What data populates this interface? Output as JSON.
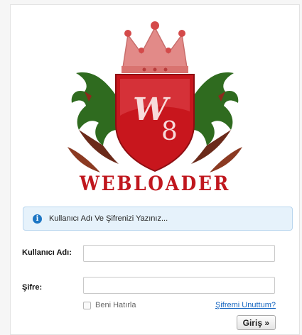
{
  "logo": {
    "monogram": "W",
    "monogram_number": "8",
    "brand": "WEBLOADER"
  },
  "info": {
    "icon": "info-icon",
    "text": "Kullanıcı Adı Ve Şifrenizi Yazınız..."
  },
  "form": {
    "username_label": "Kullanıcı Adı:",
    "username_value": "",
    "password_label": "Şifre:",
    "password_value": "",
    "remember_label": "Beni Hatırla",
    "forgot_label": "Şifremi Unuttum?",
    "submit_label": "Giriş »"
  },
  "colors": {
    "shield_red": "#c8161d",
    "crown_pink": "#e28a88",
    "dragon_green": "#2f6b1f",
    "brand_red": "#c0171e",
    "info_bg": "#e6f2fb",
    "link_blue": "#1565c0"
  }
}
